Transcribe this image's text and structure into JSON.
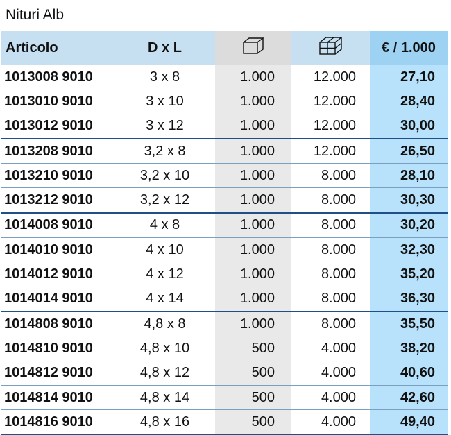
{
  "title": "Nituri Alb",
  "headers": {
    "article": "Articolo",
    "dims": "D x L",
    "pack_icon": "single-box-icon",
    "box_icon": "multi-box-icon",
    "price": "€ / 1.000"
  },
  "rows": [
    {
      "article": "1013008 9010",
      "dims": "3 x 8",
      "pack": "1.000",
      "box": "12.000",
      "price": "27,10",
      "group_end": false
    },
    {
      "article": "1013010 9010",
      "dims": "3 x 10",
      "pack": "1.000",
      "box": "12.000",
      "price": "28,40",
      "group_end": false
    },
    {
      "article": "1013012 9010",
      "dims": "3 x 12",
      "pack": "1.000",
      "box": "12.000",
      "price": "30,00",
      "group_end": true
    },
    {
      "article": "1013208 9010",
      "dims": "3,2 x 8",
      "pack": "1.000",
      "box": "12.000",
      "price": "26,50",
      "group_end": false
    },
    {
      "article": "1013210 9010",
      "dims": "3,2 x 10",
      "pack": "1.000",
      "box": "8.000",
      "price": "28,10",
      "group_end": false
    },
    {
      "article": "1013212 9010",
      "dims": "3,2 x 12",
      "pack": "1.000",
      "box": "8.000",
      "price": "30,30",
      "group_end": true
    },
    {
      "article": "1014008 9010",
      "dims": "4 x 8",
      "pack": "1.000",
      "box": "8.000",
      "price": "30,20",
      "group_end": false
    },
    {
      "article": "1014010 9010",
      "dims": "4 x 10",
      "pack": "1.000",
      "box": "8.000",
      "price": "32,30",
      "group_end": false
    },
    {
      "article": "1014012 9010",
      "dims": "4 x 12",
      "pack": "1.000",
      "box": "8.000",
      "price": "35,20",
      "group_end": false
    },
    {
      "article": "1014014 9010",
      "dims": "4 x 14",
      "pack": "1.000",
      "box": "8.000",
      "price": "36,30",
      "group_end": true
    },
    {
      "article": "1014808 9010",
      "dims": "4,8 x 8",
      "pack": "1.000",
      "box": "8.000",
      "price": "35,50",
      "group_end": false
    },
    {
      "article": "1014810 9010",
      "dims": "4,8 x 10",
      "pack": "500",
      "box": "4.000",
      "price": "38,20",
      "group_end": false
    },
    {
      "article": "1014812 9010",
      "dims": "4,8 x 12",
      "pack": "500",
      "box": "4.000",
      "price": "40,60",
      "group_end": false
    },
    {
      "article": "1014814 9010",
      "dims": "4,8 x 14",
      "pack": "500",
      "box": "4.000",
      "price": "42,60",
      "group_end": false
    },
    {
      "article": "1014816 9010",
      "dims": "4,8 x 16",
      "pack": "500",
      "box": "4.000",
      "price": "49,40",
      "group_end": true
    }
  ]
}
